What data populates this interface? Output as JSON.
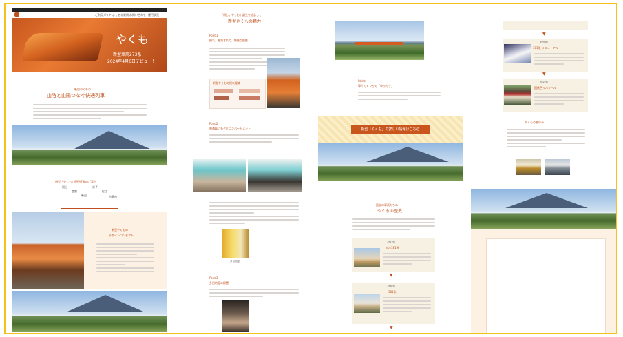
{
  "col1": {
    "nav_items": [
      "ご利用ガイド",
      "よくある質問",
      "お問い合わせ",
      "運行状況"
    ],
    "hero_title": "やくも",
    "hero_subtitle": "新型車両273系",
    "hero_date": "2024年4月6日デビュー！",
    "section1_small": "新型やくもの",
    "section1_title": "山陰と山陽つなぐ快適列車",
    "route_heading": "新型「やくも」運行区間のご案内",
    "route_stations": [
      "岡山",
      "倉敷",
      "新見",
      "米子",
      "松江",
      "出雲市"
    ],
    "feature_heading": "新型やくもの",
    "feature_sub": "デザインコンセプト"
  },
  "col2": {
    "top_heading": "「新しいやくも」誕生を記念して",
    "title": "新型やくもの魅力",
    "point1": "Point1",
    "point1_title": "揺れ、軽減されて、快適な旅路",
    "diagram_title": "新型やくもの揺れ軽減",
    "point2": "Point2",
    "point2_title": "普通車にもセミコンパートメント",
    "point3": "Point3",
    "point3_title": "多目的室の設置",
    "caption": "多目的室"
  },
  "col3": {
    "point4": "Point4",
    "point4_title": "車内でくつろぐ「ゆったり」",
    "banner_button": "新型「やくも」の詳しい情報はこちら",
    "history_small": "過去の車両たちの",
    "history_title": "やくもの歴史",
    "card1_label": "1972年",
    "card1_title": "キハ181系",
    "card2_label": "1982年",
    "card2_title": "381系"
  },
  "col4": {
    "card3_label": "1994年",
    "card3_title": "381系 リニューアル",
    "card4_label": "2022年",
    "card4_title": "国鉄色リバイバル",
    "section_title": "やくものあゆみ"
  },
  "colors": {
    "accent": "#c0511e",
    "frame": "#f4c21a",
    "cream": "#f7f1e3"
  }
}
